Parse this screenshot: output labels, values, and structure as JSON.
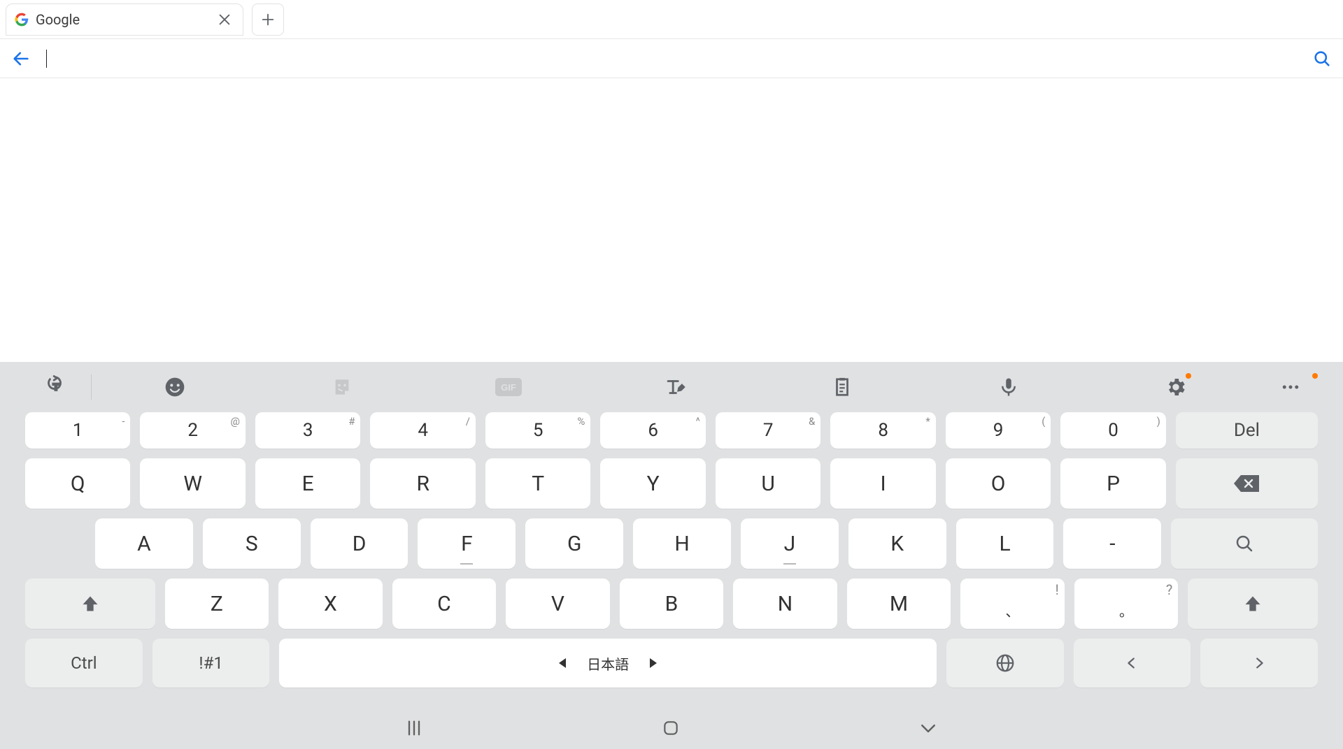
{
  "tab": {
    "title": "Google"
  },
  "omnibox": {
    "value": ""
  },
  "keyboard": {
    "numbers": [
      {
        "label": "1",
        "sup": "-"
      },
      {
        "label": "2",
        "sup": "@"
      },
      {
        "label": "3",
        "sup": "#"
      },
      {
        "label": "4",
        "sup": "/"
      },
      {
        "label": "5",
        "sup": "%"
      },
      {
        "label": "6",
        "sup": "^"
      },
      {
        "label": "7",
        "sup": "&"
      },
      {
        "label": "8",
        "sup": "*"
      },
      {
        "label": "9",
        "sup": "("
      },
      {
        "label": "0",
        "sup": ")"
      }
    ],
    "del_label": "Del",
    "row_q": [
      "Q",
      "W",
      "E",
      "R",
      "T",
      "Y",
      "U",
      "I",
      "O",
      "P"
    ],
    "row_a": [
      "A",
      "S",
      "D",
      "F",
      "G",
      "H",
      "J",
      "K",
      "L",
      "-"
    ],
    "row_z": [
      "Z",
      "X",
      "C",
      "V",
      "B",
      "N",
      "M"
    ],
    "comma_main": "、",
    "comma_sup": "!",
    "period_main": "。",
    "period_sup": "?",
    "ctrl_label": "Ctrl",
    "symbols_label": "!#1",
    "space_label": "日本語"
  }
}
